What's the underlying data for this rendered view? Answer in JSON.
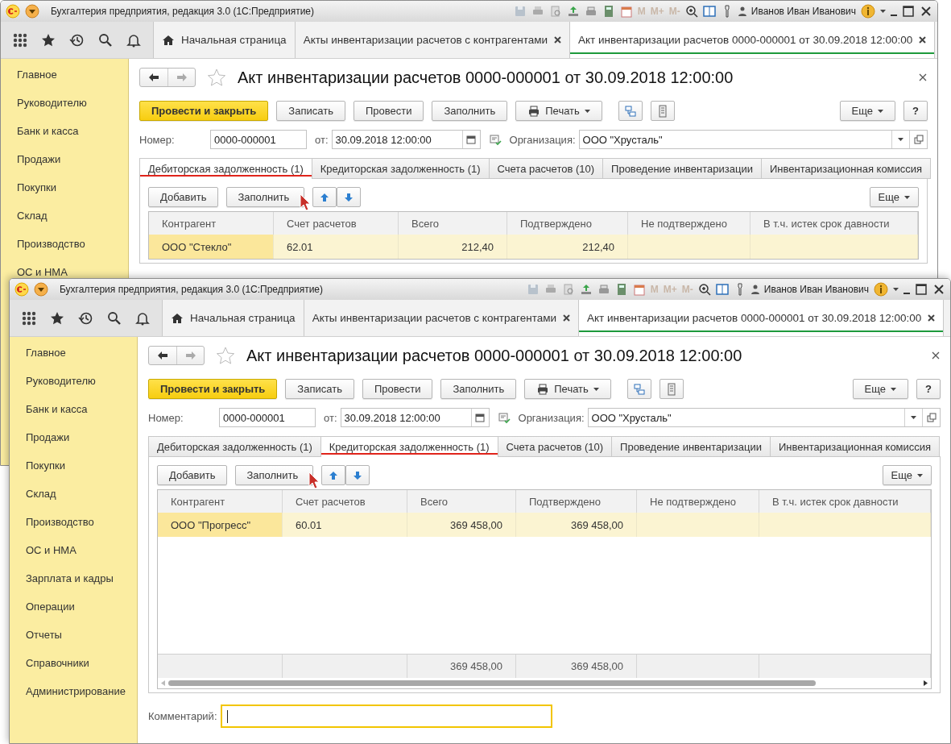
{
  "windows": [
    {
      "app_title": "Бухгалтерия предприятия, редакция 3.0  (1С:Предприятие)",
      "memory_buttons": [
        "M",
        "M+",
        "M-"
      ],
      "user": "Иванов Иван Иванович",
      "top_tabs": [
        {
          "label": "Начальная страница",
          "kind": "home",
          "selected": false
        },
        {
          "label": "Акты инвентаризации расчетов с контрагентами",
          "kind": "closable",
          "selected": false
        },
        {
          "label": "Акт инвентаризации расчетов 0000-000001 от 30.09.2018 12:00:00",
          "kind": "closable",
          "selected": true
        }
      ],
      "sidebar": [
        "Главное",
        "Руководителю",
        "Банк и касса",
        "Продажи",
        "Покупки",
        "Склад",
        "Производство",
        "ОС и НМА"
      ],
      "document": {
        "title": "Акт инвентаризации расчетов 0000-000001 от 30.09.2018 12:00:00",
        "buttons": [
          {
            "label": "Провести и закрыть",
            "kind": "primary"
          },
          {
            "label": "Записать",
            "kind": "plain"
          },
          {
            "label": "Провести",
            "kind": "plain"
          },
          {
            "label": "Заполнить",
            "kind": "plain"
          },
          {
            "label": "Печать",
            "kind": "print"
          },
          {
            "kind": "structure"
          },
          {
            "kind": "report"
          },
          {
            "label": "Еще",
            "kind": "more"
          },
          {
            "label": "?",
            "kind": "help"
          }
        ],
        "number": {
          "label": "Номер:",
          "value": "0000-000001"
        },
        "date": {
          "label": "от:",
          "value": "30.09.2018 12:00:00"
        },
        "organization": {
          "label": "Организация:",
          "value": "ООО \"Хрусталь\""
        },
        "tabs": [
          {
            "label": "Дебиторская задолженность (1)",
            "selected": true
          },
          {
            "label": "Кредиторская задолженность (1)",
            "selected": false
          },
          {
            "label": "Счета расчетов (10)",
            "selected": false
          },
          {
            "label": "Проведение инвентаризации",
            "selected": false
          },
          {
            "label": "Инвентаризационная комиссия",
            "selected": false
          }
        ],
        "table_buttons": {
          "add": "Добавить",
          "fill": "Заполнить",
          "more": "Еще"
        },
        "table": {
          "columns": [
            "Контрагент",
            "Счет расчетов",
            "Всего",
            "Подтверждено",
            "Не подтверждено",
            "В т.ч. истек срок давности"
          ],
          "rows": [
            {
              "cells": [
                "ООО \"Стекло\"",
                "62.01",
                "212,40",
                "212,40",
                null,
                null
              ],
              "selected": true
            }
          ]
        }
      }
    },
    {
      "app_title": "Бухгалтерия предприятия, редакция 3.0  (1С:Предприятие)",
      "memory_buttons": [
        "M",
        "M+",
        "M-"
      ],
      "user": "Иванов Иван Иванович",
      "top_tabs": [
        {
          "label": "Начальная страница",
          "kind": "home",
          "selected": false
        },
        {
          "label": "Акты инвентаризации расчетов с контрагентами",
          "kind": "closable",
          "selected": false
        },
        {
          "label": "Акт инвентаризации расчетов 0000-000001 от 30.09.2018 12:00:00",
          "kind": "closable",
          "selected": true
        }
      ],
      "sidebar": [
        "Главное",
        "Руководителю",
        "Банк и касса",
        "Продажи",
        "Покупки",
        "Склад",
        "Производство",
        "ОС и НМА",
        "Зарплата и кадры",
        "Операции",
        "Отчеты",
        "Справочники",
        "Администрирование"
      ],
      "document": {
        "title": "Акт инвентаризации расчетов 0000-000001 от 30.09.2018 12:00:00",
        "buttons": [
          {
            "label": "Провести и закрыть",
            "kind": "primary"
          },
          {
            "label": "Записать",
            "kind": "plain"
          },
          {
            "label": "Провести",
            "kind": "plain"
          },
          {
            "label": "Заполнить",
            "kind": "plain"
          },
          {
            "label": "Печать",
            "kind": "print"
          },
          {
            "kind": "structure"
          },
          {
            "kind": "report"
          },
          {
            "label": "Еще",
            "kind": "more"
          },
          {
            "label": "?",
            "kind": "help"
          }
        ],
        "number": {
          "label": "Номер:",
          "value": "0000-000001"
        },
        "date": {
          "label": "от:",
          "value": "30.09.2018 12:00:00"
        },
        "organization": {
          "label": "Организация:",
          "value": "ООО \"Хрусталь\""
        },
        "tabs": [
          {
            "label": "Дебиторская задолженность (1)",
            "selected": false
          },
          {
            "label": "Кредиторская задолженность (1)",
            "selected": true
          },
          {
            "label": "Счета расчетов (10)",
            "selected": false
          },
          {
            "label": "Проведение инвентаризации",
            "selected": false
          },
          {
            "label": "Инвентаризационная комиссия",
            "selected": false
          }
        ],
        "table_buttons": {
          "add": "Добавить",
          "fill": "Заполнить",
          "more": "Еще"
        },
        "table": {
          "columns": [
            "Контрагент",
            "Счет расчетов",
            "Всего",
            "Подтверждено",
            "Не подтверждено",
            "В т.ч. истек срок давности"
          ],
          "rows": [
            {
              "cells": [
                "ООО \"Прогресс\"",
                "60.01",
                "369 458,00",
                "369 458,00",
                null,
                null
              ],
              "selected": true
            }
          ],
          "footer": {
            "total": "369 458,00",
            "confirmed": "369 458,00"
          }
        },
        "comment": {
          "label": "Комментарий:",
          "focused": true
        }
      }
    }
  ]
}
